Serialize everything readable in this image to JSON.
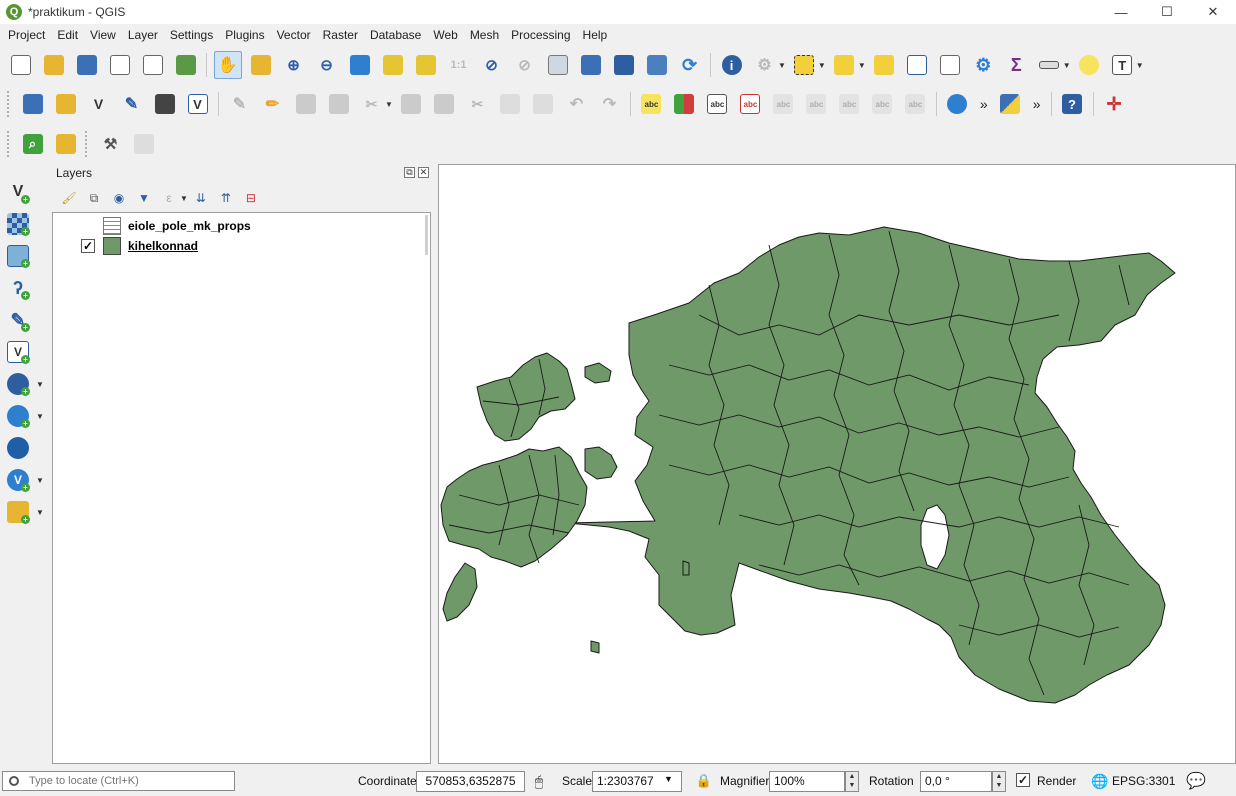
{
  "window": {
    "title": "*praktikum - QGIS",
    "app_icon": "qgis-logo",
    "minimize": "—",
    "maximize": "☐",
    "close": "✕"
  },
  "menu": [
    "Project",
    "Edit",
    "View",
    "Layer",
    "Settings",
    "Plugins",
    "Vector",
    "Raster",
    "Database",
    "Web",
    "Mesh",
    "Processing",
    "Help"
  ],
  "toolbars": {
    "file": [
      "new-project-icon",
      "open-project-icon",
      "save-project-icon",
      "new-print-layout-icon",
      "layout-manager-icon",
      "style-manager-icon"
    ],
    "navigation": [
      "pan-icon",
      "pan-to-selection-icon",
      "zoom-in-icon",
      "zoom-out-icon",
      "zoom-full-icon",
      "zoom-to-selection-icon",
      "zoom-to-layer-icon",
      "zoom-native-icon",
      "zoom-last-icon",
      "zoom-next-icon",
      "new-map-view-icon",
      "temporal-controller-icon",
      "new-bookmark-icon",
      "show-bookmarks-icon",
      "refresh-icon"
    ],
    "attributes": [
      "identify-icon",
      "run-action-icon",
      "select-features-icon",
      "select-by-value-icon",
      "deselect-icon",
      "open-attribute-table-icon",
      "statistical-summary-icon",
      "toolbox-icon",
      "field-calculator-icon",
      "measure-icon",
      "map-tips-icon",
      "text-annotation-icon"
    ],
    "python_label": "»",
    "abc": "abc"
  },
  "layers_panel": {
    "title": "Layers",
    "undock": "⧉",
    "close": "✕",
    "layers": [
      {
        "name": "eiole_pole_mk_props",
        "type": "table",
        "checked": false
      },
      {
        "name": "kihelkonnad",
        "type": "polygon",
        "checked": true,
        "color": "#6f9968"
      }
    ]
  },
  "map": {
    "fill_color": "#6f9968",
    "stroke_color": "#1a1a1a",
    "background": "#ffffff"
  },
  "status": {
    "locate_placeholder": "Type to locate (Ctrl+K)",
    "coordinate_label": "Coordinate",
    "coordinate_value": "570853,6352875",
    "scale_label": "Scale",
    "scale_value": "1:2303767",
    "magnifier_label": "Magnifier",
    "magnifier_value": "100%",
    "rotation_label": "Rotation",
    "rotation_value": "0,0 °",
    "render_label": "Render",
    "render_checked": true,
    "crs": "EPSG:3301"
  }
}
